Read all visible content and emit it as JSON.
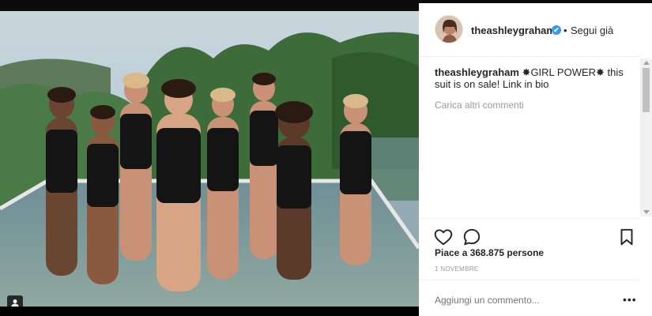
{
  "post": {
    "username": "theashleygraham",
    "follow_label": "Segui già",
    "separator": "•",
    "verified_mark": "✔",
    "caption_user": "theashleygraham",
    "caption_text": " ✸GIRL POWER✸ this suit is on sale! Link in bio",
    "load_more": "Carica altri commenti",
    "likes": "Piace a 368.875 persone",
    "date": "1 NOVEMBRE",
    "comment_placeholder": "Aggiungi un commento...",
    "more_label": "•••"
  },
  "icons": {
    "like": "heart-outline-icon",
    "comment": "speech-bubble-icon",
    "save": "bookmark-icon",
    "user_tag": "person-icon",
    "verified": "verified-badge-icon"
  },
  "colors": {
    "accent": "#3897f0",
    "text": "#262626",
    "muted": "#999999"
  }
}
